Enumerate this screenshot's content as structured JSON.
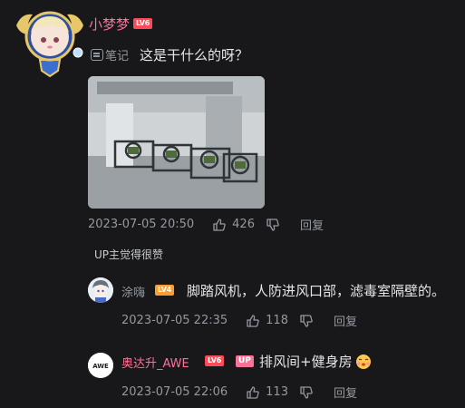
{
  "main_comment": {
    "username": "小梦梦",
    "level": "LV6",
    "note_label": "笔记",
    "text": "这是干什么的呀？",
    "timestamp": "2023-07-05 20:50",
    "likes": "426",
    "reply_label": "回复",
    "up_liked": "UP主觉得很赞"
  },
  "replies": [
    {
      "username": "涂嗨",
      "level": "LV4",
      "text": "脚踏风机，人防进风口部，滤毒室隔壁的。",
      "timestamp": "2023-07-05 22:35",
      "likes": "118",
      "reply_label": "回复"
    },
    {
      "username": "奥达升_AWE",
      "level": "LV6",
      "badge": "UP",
      "text": "排风间+健身房",
      "avatar_text": "AWE",
      "timestamp": "2023-07-05 22:06",
      "likes": "113",
      "reply_label": "回复"
    }
  ],
  "colors": {
    "background": "#18181a",
    "pink": "#fb7299",
    "muted": "#9499a0"
  }
}
